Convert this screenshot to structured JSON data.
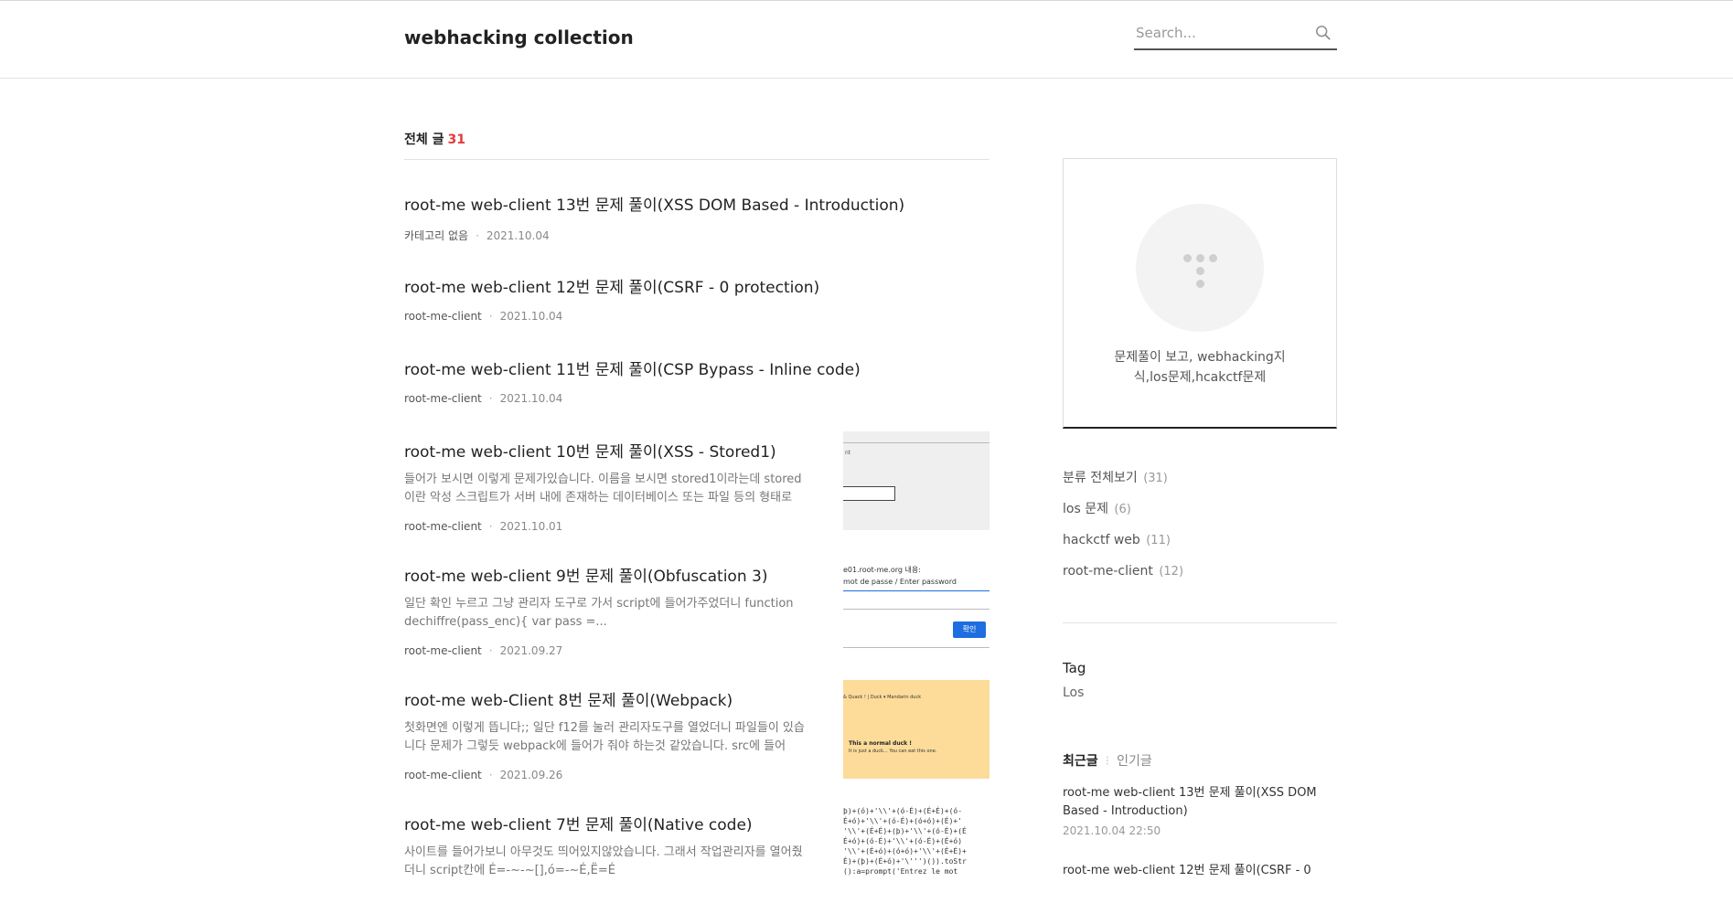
{
  "header": {
    "blog_title": "webhacking collection",
    "search_placeholder": "Search..."
  },
  "list": {
    "heading": "전체 글",
    "count": "31"
  },
  "posts": [
    {
      "title": "root-me web-client 13번 문제 풀이(XSS DOM Based - Introduction)",
      "category": "카테고리 없음",
      "date": "2021.10.04"
    },
    {
      "title": "root-me web-client 12번 문제 풀이(CSRF - 0 protection)",
      "category": "root-me-client",
      "date": "2021.10.04"
    },
    {
      "title": "root-me web-client 11번 문제 풀이(CSP Bypass - Inline code)",
      "category": "root-me-client",
      "date": "2021.10.04"
    },
    {
      "title": "root-me web-client 10번 문제 풀이(XSS - Stored1)",
      "excerpt": "들어가 보시면 이렇게 문제가있습니다. 이름을 보시면 stored1이라는데 stored이란 악성 스크립트가 서버 내에 존재하는 데이터베이스 또는 파일 등의 형태로 저...",
      "category": "root-me-client",
      "date": "2021.10.01"
    },
    {
      "title": "root-me web-client 9번 문제 풀이(Obfuscation 3)",
      "excerpt": "일단 확인 누르고 그냥 관리자 도구로 가서 script에 들어가주었더니 function dechiffre(pass_enc){ var pass =...",
      "category": "root-me-client",
      "date": "2021.09.27"
    },
    {
      "title": "root-me web-Client 8번 문제 풀이(Webpack)",
      "excerpt": "첫화면엔 이렇게 뜹니다;; 일단 f12를 눌러 관리자도구를 열었더니 파일들이 있습니다 문제가 그렇듯 webpack에 들어가 줘야 하는것 같았습니다. src에 들어가...",
      "category": "root-me-client",
      "date": "2021.09.26"
    },
    {
      "title": "root-me web-client 7번 문제 풀이(Native code)",
      "excerpt": "사이트를 들어가보니 아무것도 띄어있지않았습니다. 그래서 작업관리자를 열어줬더니 script칸에 É=-~-~[],ó=-~É,Ë=É",
      "category": "root-me-client",
      "date": ""
    }
  ],
  "thumbs": {
    "t10_small": "nt",
    "t9_line1": "e01.root-me.org 내용:",
    "t9_line2": "mot de passe / Enter password",
    "t9_button": "확인",
    "t8_nav": "& Quack ! |  Duck  ▾   Mandarin duck",
    "t8_line1": "This a normal duck !",
    "t8_line2": "It is just a duck... You can eat this one.",
    "t7_lines": [
      "þ)+(ó)+'\\\\'+(ó-É)+(É+É)+(ó-",
      "É+ó)+'\\\\'+(ó-É)+(ó+ó)+(É)+'",
      "'\\\\'+(É+É)+(þ)+'\\\\'+(ó-É)+(É",
      "É+ó)+(ó-É)+'\\\\'+(ó-É)+(É+ó)",
      "'\\\\'+(É+ó)+(ó+ó)+'\\\\'+(É+É)+",
      "É)+(þ)+(É+ó)+'\\''')()).toStr",
      "():a=prompt('Entrez le mot"
    ]
  },
  "sidebar": {
    "profile_desc": "문제풀이 보고, webhacking지식,los문제,hcakctf문제",
    "categories": [
      {
        "name": "분류 전체보기",
        "count": "(31)"
      },
      {
        "name": "los 문제",
        "count": "(6)"
      },
      {
        "name": "hackctf web",
        "count": "(11)"
      },
      {
        "name": "root-me-client",
        "count": "(12)"
      }
    ],
    "tag_title": "Tag",
    "tags": [
      "Los"
    ],
    "tab_recent": "최근글",
    "tab_popular": "인기글",
    "recent": [
      {
        "title": "root-me web-client 13번 문제 풀이(XSS DOM Based - Introduction)",
        "date": "2021.10.04 22:50"
      },
      {
        "title": "root-me web-client 12번 문제 풀이(CSRF - 0",
        "date": ""
      }
    ]
  },
  "colors": {
    "accent": "#e23b3b",
    "thumb8_bg": "#fddc9a",
    "thumb_button": "#1e6ee0"
  }
}
